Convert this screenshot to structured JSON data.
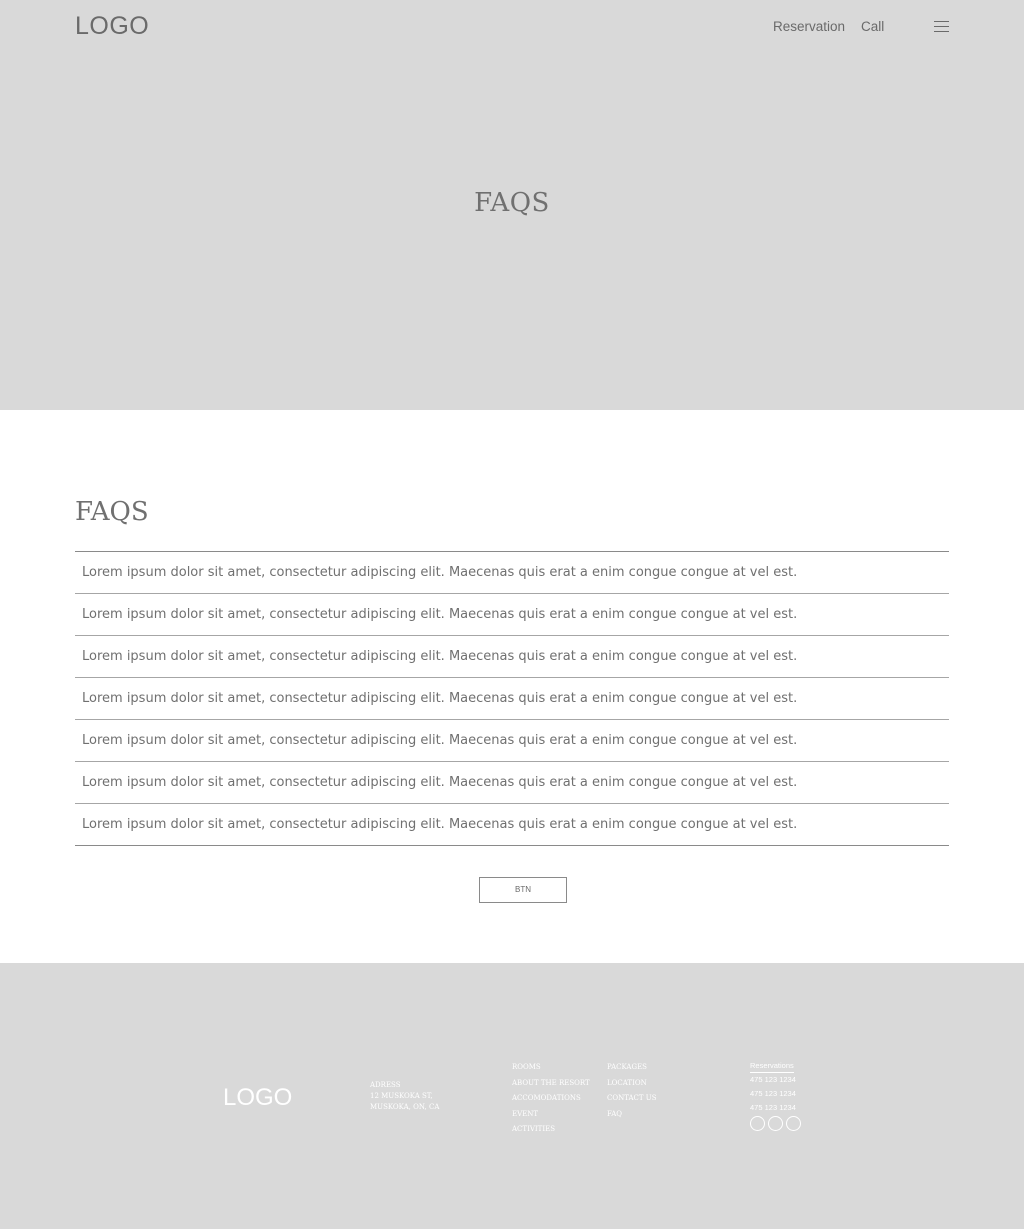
{
  "header": {
    "logo": "LOGO",
    "nav": {
      "reservation": "Reservation",
      "call": "Call"
    },
    "menu_icon": "hamburger-menu-icon"
  },
  "hero": {
    "title": "FAQS"
  },
  "faq": {
    "heading": "FAQS",
    "items": [
      "Lorem ipsum dolor sit amet, consectetur adipiscing elit. Maecenas quis erat a enim congue congue at vel est.",
      "Lorem ipsum dolor sit amet, consectetur adipiscing elit. Maecenas quis erat a enim congue congue at vel est.",
      "Lorem ipsum dolor sit amet, consectetur adipiscing elit. Maecenas quis erat a enim congue congue at vel est.",
      "Lorem ipsum dolor sit amet, consectetur adipiscing elit. Maecenas quis erat a enim congue congue at vel est.",
      "Lorem ipsum dolor sit amet, consectetur adipiscing elit. Maecenas quis erat a enim congue congue at vel est.",
      "Lorem ipsum dolor sit amet, consectetur adipiscing elit. Maecenas quis erat a enim congue congue at vel est.",
      "Lorem ipsum dolor sit amet, consectetur adipiscing elit. Maecenas quis erat a enim congue congue at vel est."
    ],
    "button_label": "BTN"
  },
  "footer": {
    "logo": "LOGO",
    "address": {
      "label": "ADRESS",
      "line1": "12 MUSKOKA ST,",
      "line2": "MUSKOKA, ON, CA"
    },
    "links_col1": [
      "ROOMS",
      "ABOUT THE RESORT",
      "ACCOMODATIONS",
      "EVENT",
      "ACTIVITIES"
    ],
    "links_col2": [
      "PACKAGES",
      "LOCATION",
      "CONTACT US",
      "FAQ"
    ],
    "contact": {
      "title": "Reservations",
      "phones": [
        "475 123 1234",
        "475 123 1234",
        "475 123 1234"
      ]
    },
    "social_icons": [
      "social-icon-1",
      "social-icon-2",
      "social-icon-3"
    ]
  },
  "colors": {
    "placeholder_gray": "#d9d9d9",
    "text_gray": "#707070",
    "divider": "#a6a6a6",
    "white": "#ffffff"
  }
}
